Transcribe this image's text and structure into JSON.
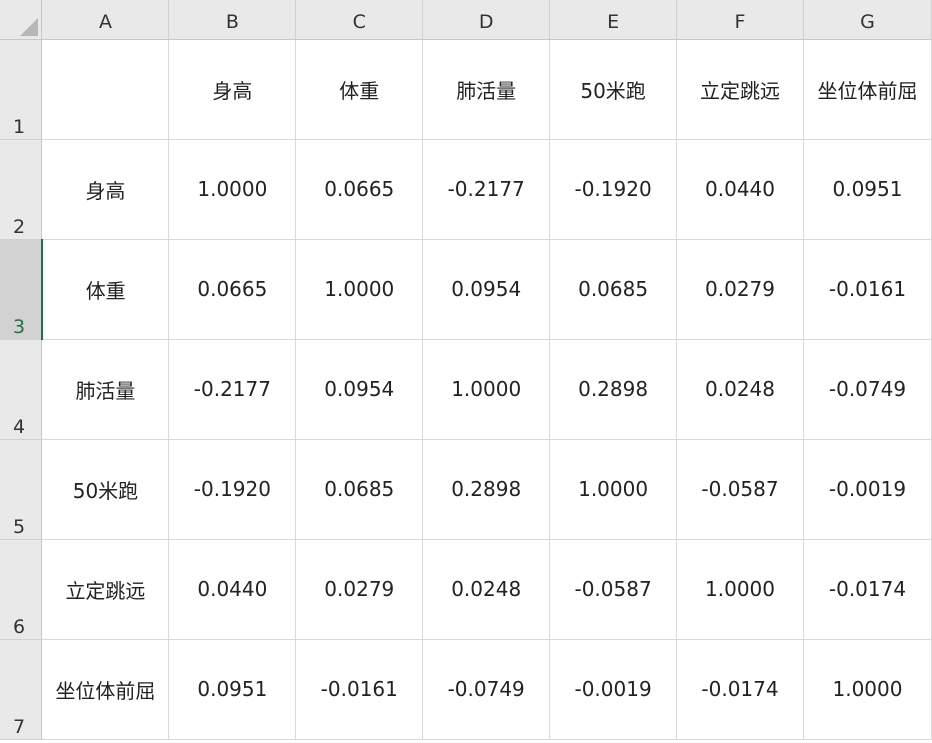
{
  "columns": [
    "A",
    "B",
    "C",
    "D",
    "E",
    "F",
    "G"
  ],
  "rows": [
    {
      "number": "1",
      "cells": [
        "",
        "身高",
        "体重",
        "肺活量",
        "50米跑",
        "立定跳远",
        "坐位体前屈"
      ]
    },
    {
      "number": "2",
      "cells": [
        "身高",
        "1.0000",
        "0.0665",
        "-0.2177",
        "-0.1920",
        "0.0440",
        "0.0951"
      ]
    },
    {
      "number": "3",
      "cells": [
        "体重",
        "0.0665",
        "1.0000",
        "0.0954",
        "0.0685",
        "0.0279",
        "-0.0161"
      ]
    },
    {
      "number": "4",
      "cells": [
        "肺活量",
        "-0.2177",
        "0.0954",
        "1.0000",
        "0.2898",
        "0.0248",
        "-0.0749"
      ]
    },
    {
      "number": "5",
      "cells": [
        "50米跑",
        "-0.1920",
        "0.0685",
        "0.2898",
        "1.0000",
        "-0.0587",
        "-0.0019"
      ]
    },
    {
      "number": "6",
      "cells": [
        "立定跳远",
        "0.0440",
        "0.0279",
        "0.0248",
        "-0.0587",
        "1.0000",
        "-0.0174"
      ]
    },
    {
      "number": "7",
      "cells": [
        "坐位体前屈",
        "0.0951",
        "-0.0161",
        "-0.0749",
        "-0.0019",
        "-0.0174",
        "1.0000"
      ]
    }
  ],
  "selected_row": "3",
  "colors": {
    "header_bg": "#e9e9e9",
    "selected_header_bg": "#d2d2d2",
    "selection_accent": "#217346",
    "gridline": "#d9d9d9"
  }
}
